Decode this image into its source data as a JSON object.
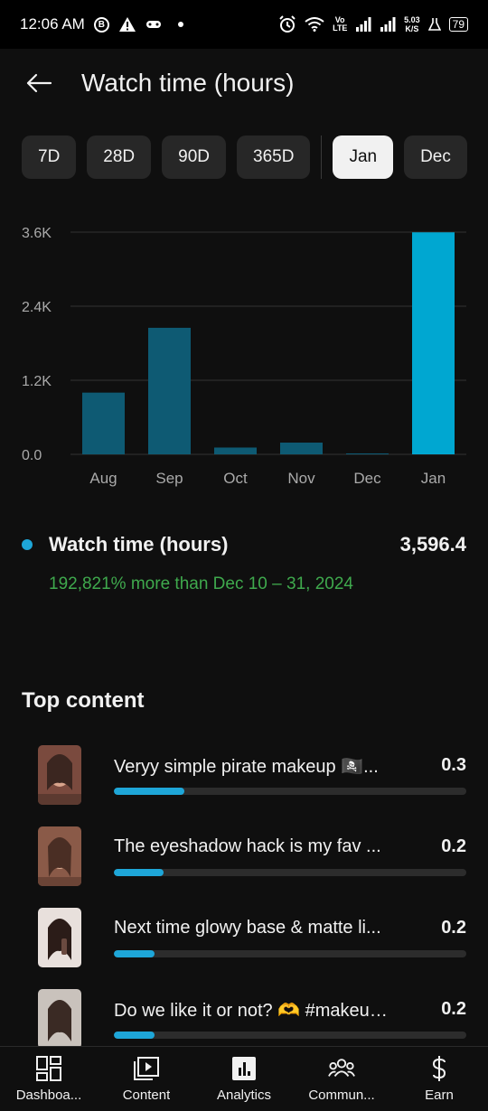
{
  "status_bar": {
    "time": "12:06 AM",
    "badge": "B",
    "network": "Vo LTE",
    "speed_value": "5.03",
    "speed_unit": "K/S",
    "battery": "79"
  },
  "header": {
    "title": "Watch time (hours)",
    "back_icon": "arrow-left-icon"
  },
  "chips": [
    {
      "label": "7D",
      "selected": false
    },
    {
      "label": "28D",
      "selected": false
    },
    {
      "label": "90D",
      "selected": false
    },
    {
      "label": "365D",
      "selected": false
    },
    {
      "label": "Jan",
      "selected": true
    },
    {
      "label": "Dec",
      "selected": false
    }
  ],
  "chart_data": {
    "type": "bar",
    "categories": [
      "Aug",
      "Sep",
      "Oct",
      "Nov",
      "Dec",
      "Jan"
    ],
    "values": [
      1000,
      2050,
      110,
      190,
      15,
      3596.4
    ],
    "yticks": [
      "0.0",
      "1.2K",
      "2.4K",
      "3.6K"
    ],
    "ytick_values": [
      0,
      1200,
      2400,
      3600
    ],
    "ylim": [
      0,
      3600
    ],
    "highlight_index": 5,
    "colors": {
      "bar": "#0e5a73",
      "highlight": "#00a7d1",
      "grid": "#333333",
      "label": "#aaaaaa"
    }
  },
  "metric": {
    "label": "Watch time (hours)",
    "value": "3,596.4",
    "comparison": "192,821% more than Dec 10 – 31, 2024",
    "dot_color": "#1ea6d8",
    "comparison_color": "#3fa94d"
  },
  "top_content": {
    "title": "Top content",
    "items": [
      {
        "title": "Veryy simple pirate makeup 🏴‍☠️...",
        "value": "0.3",
        "bar_fraction": 0.2
      },
      {
        "title": "The eyeshadow hack is my fav ...",
        "value": "0.2",
        "bar_fraction": 0.14
      },
      {
        "title": "Next time glowy base & matte li...",
        "value": "0.2",
        "bar_fraction": 0.115
      },
      {
        "title": "Do we like it or not? 🫶 #makeupt...",
        "value": "0.2",
        "bar_fraction": 0.115
      }
    ]
  },
  "bottom_nav": [
    {
      "label": "Dashboa...",
      "icon": "dashboard-icon"
    },
    {
      "label": "Content",
      "icon": "content-icon"
    },
    {
      "label": "Analytics",
      "icon": "analytics-icon"
    },
    {
      "label": "Commun...",
      "icon": "community-icon"
    },
    {
      "label": "Earn",
      "icon": "dollar-icon"
    }
  ]
}
